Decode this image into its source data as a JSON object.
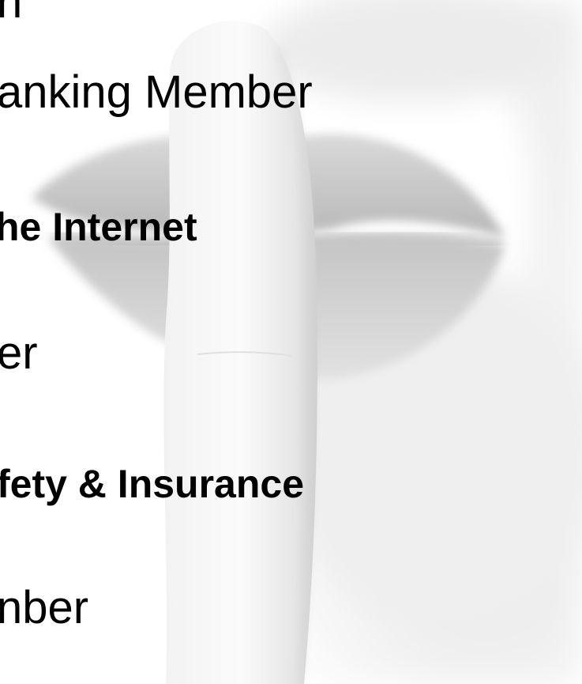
{
  "slide": {
    "lines": [
      {
        "text": "n"
      },
      {
        "text": "anking Member"
      },
      {
        "text": "he Internet"
      },
      {
        "text": "er"
      },
      {
        "text": "fety & Insurance"
      },
      {
        "text": "nber"
      }
    ]
  },
  "background": {
    "subject": "grayscale photo of lips with a finger raised in a hush gesture",
    "colors": {
      "light": "#f4f4f4",
      "mid": "#d2d2d2",
      "dark": "#a8a8a8"
    }
  }
}
